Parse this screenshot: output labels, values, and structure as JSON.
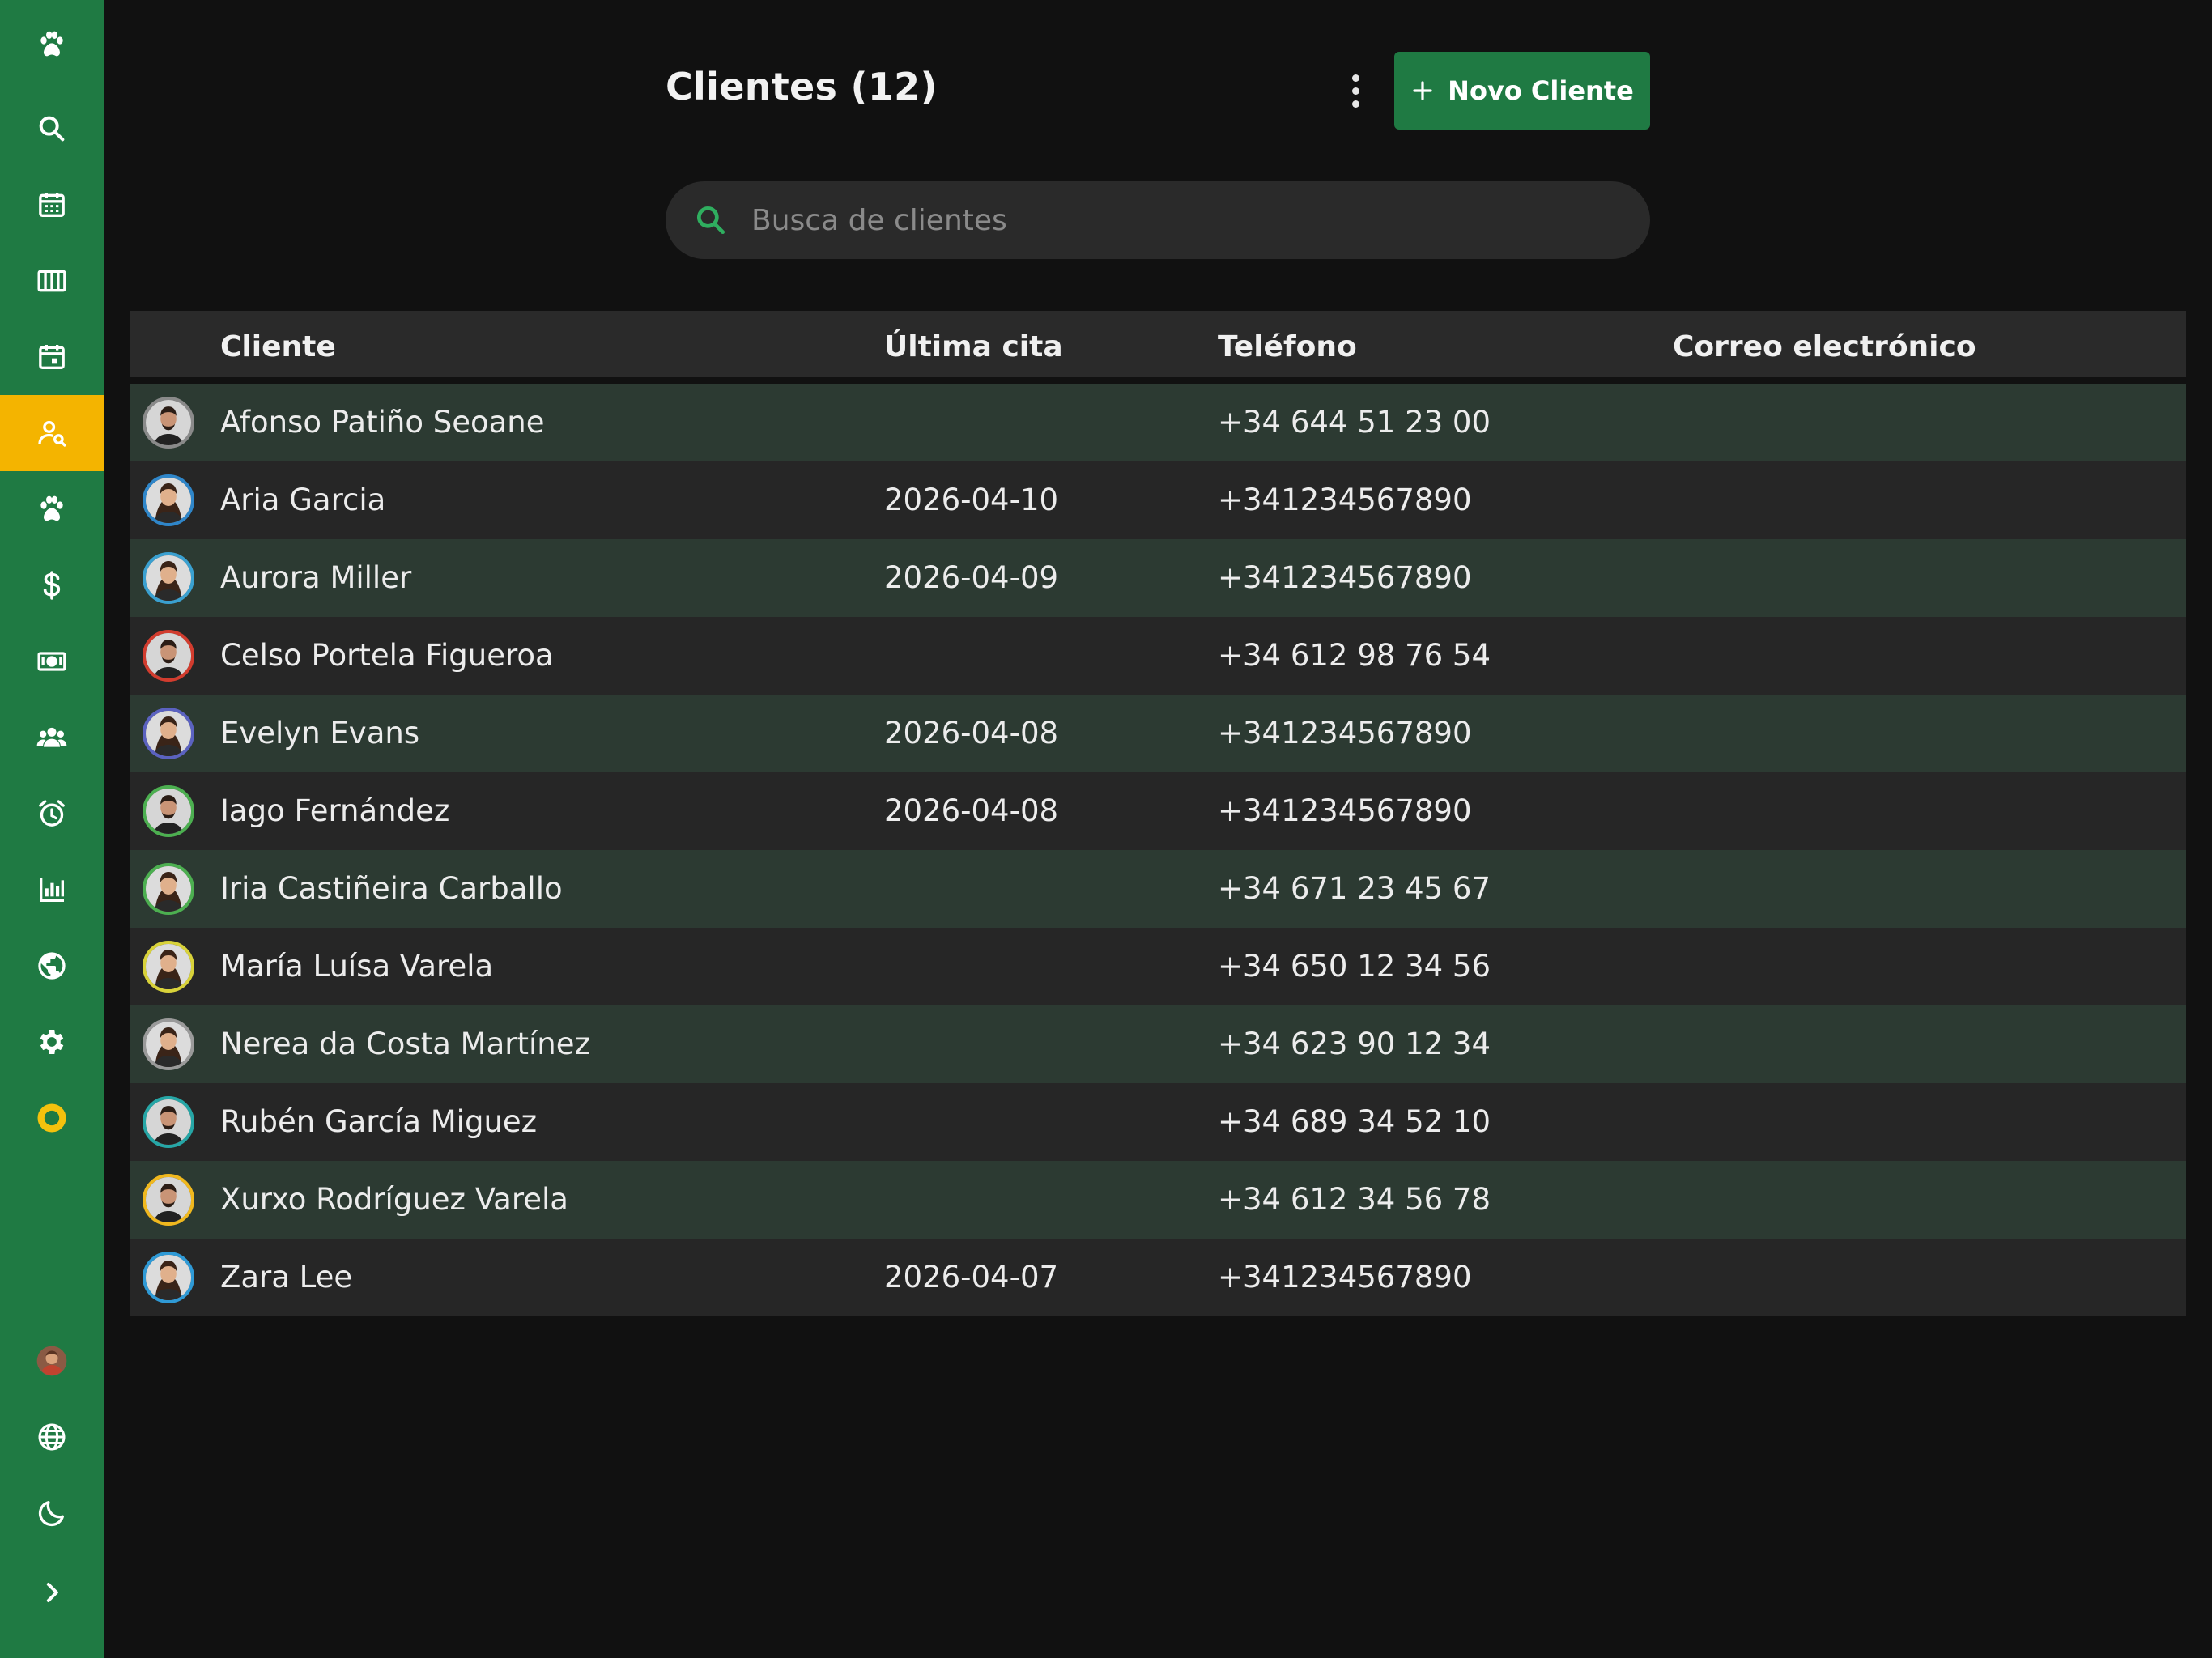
{
  "sidebar": {
    "items": [
      {
        "icon": "paw-icon",
        "name": "sidebar-item-home"
      },
      {
        "icon": "search-icon",
        "name": "sidebar-item-search"
      },
      {
        "icon": "calendar-icon",
        "name": "sidebar-item-calendar"
      },
      {
        "icon": "columns-icon",
        "name": "sidebar-item-board"
      },
      {
        "icon": "calendar-event-icon",
        "name": "sidebar-item-appointments"
      },
      {
        "icon": "user-search-icon",
        "name": "sidebar-item-clients",
        "active": true
      },
      {
        "icon": "paw-icon",
        "name": "sidebar-item-pets"
      },
      {
        "icon": "dollar-icon",
        "name": "sidebar-item-payments"
      },
      {
        "icon": "cash-icon",
        "name": "sidebar-item-cash"
      },
      {
        "icon": "users-icon",
        "name": "sidebar-item-team"
      },
      {
        "icon": "alarm-icon",
        "name": "sidebar-item-reminders"
      },
      {
        "icon": "bar-chart-icon",
        "name": "sidebar-item-reports"
      },
      {
        "icon": "globe-icon",
        "name": "sidebar-item-web"
      },
      {
        "icon": "gear-icon",
        "name": "sidebar-item-settings"
      },
      {
        "icon": "ring-icon",
        "name": "sidebar-item-status"
      }
    ],
    "bottom": [
      {
        "icon": "user-avatar-icon",
        "name": "sidebar-profile"
      },
      {
        "icon": "language-globe-icon",
        "name": "sidebar-language"
      },
      {
        "icon": "moon-icon",
        "name": "sidebar-theme-toggle"
      },
      {
        "icon": "chevron-right-icon",
        "name": "sidebar-expand"
      }
    ],
    "colors": {
      "background": "#1f7a43",
      "active": "#f4b400"
    }
  },
  "header": {
    "title": "Clientes (12)",
    "new_button_label": "Novo Cliente"
  },
  "search": {
    "placeholder": "Busca de clientes",
    "value": ""
  },
  "table": {
    "columns": [
      "Cliente",
      "Última cita",
      "Teléfono",
      "Correo electrónico"
    ],
    "rows": [
      {
        "name": "Afonso Patiño Seoane",
        "last": "",
        "phone": "+34 644 51 23 00",
        "email": "",
        "ring": "#8a8a8a",
        "gender": "m"
      },
      {
        "name": "Aria Garcia",
        "last": "2026-04-10",
        "phone": "+341234567890",
        "email": "",
        "ring": "#2f86c9",
        "gender": "f"
      },
      {
        "name": "Aurora Miller",
        "last": "2026-04-09",
        "phone": "+341234567890",
        "email": "",
        "ring": "#3aa0d0",
        "gender": "f"
      },
      {
        "name": "Celso Portela Figueroa",
        "last": "",
        "phone": "+34 612 98 76 54",
        "email": "",
        "ring": "#d23c2e",
        "gender": "m"
      },
      {
        "name": "Evelyn Evans",
        "last": "2026-04-08",
        "phone": "+341234567890",
        "email": "",
        "ring": "#5b62c0",
        "gender": "f"
      },
      {
        "name": "Iago Fernández",
        "last": "2026-04-08",
        "phone": "+341234567890",
        "email": "",
        "ring": "#4caf50",
        "gender": "m"
      },
      {
        "name": "Iria Castiñeira Carballo",
        "last": "",
        "phone": "+34 671 23 45 67",
        "email": "",
        "ring": "#4caf50",
        "gender": "f"
      },
      {
        "name": "María Luísa Varela",
        "last": "",
        "phone": "+34 650 12 34 56",
        "email": "",
        "ring": "#d8d23a",
        "gender": "f"
      },
      {
        "name": "Nerea da Costa Martínez",
        "last": "",
        "phone": "+34 623 90 12 34",
        "email": "",
        "ring": "#9a9a9a",
        "gender": "f"
      },
      {
        "name": "Rubén García Miguez",
        "last": "",
        "phone": "+34 689 34 52 10",
        "email": "",
        "ring": "#26a6a6",
        "gender": "m"
      },
      {
        "name": "Xurxo Rodríguez Varela",
        "last": "",
        "phone": "+34 612 34 56 78",
        "email": "",
        "ring": "#f0b81e",
        "gender": "m"
      },
      {
        "name": "Zara Lee",
        "last": "2026-04-07",
        "phone": "+341234567890",
        "email": "",
        "ring": "#2f9ad6",
        "gender": "f"
      }
    ]
  }
}
